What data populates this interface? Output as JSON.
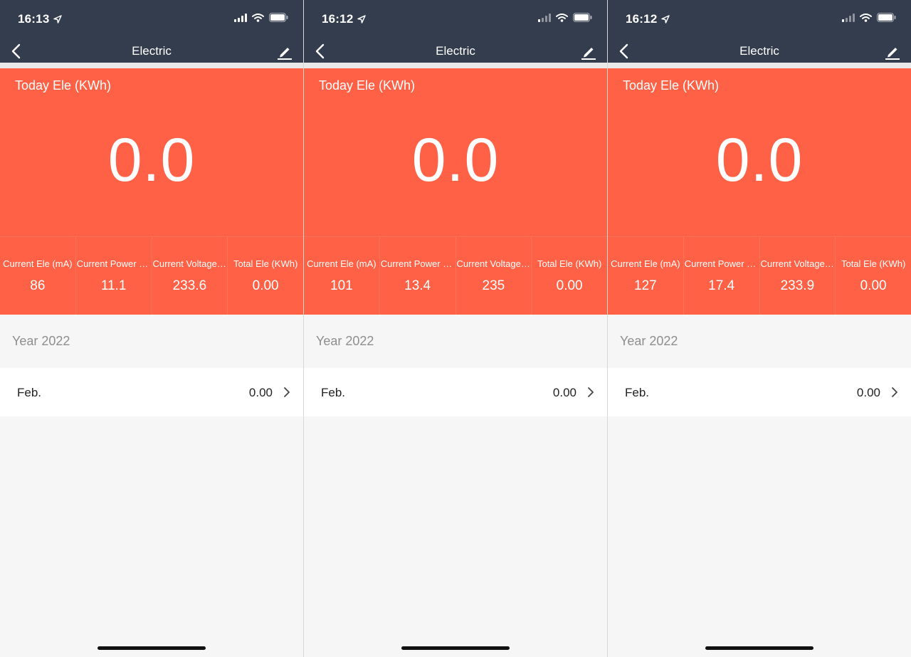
{
  "colors": {
    "header": "#343d4e",
    "card": "#fe6145",
    "background": "#f6f6f6"
  },
  "icons": [
    "location-arrow-icon",
    "signal-icon",
    "wifi-icon",
    "battery-icon",
    "back-chevron-icon",
    "edit-pencil-icon",
    "chevron-right-icon"
  ],
  "screens": [
    {
      "time": "16:13",
      "title": "Electric",
      "today_label": "Today Ele (KWh)",
      "today_value": "0.0",
      "stats": [
        {
          "label": "Current Ele (mA)",
          "value": "86"
        },
        {
          "label": "Current Power (W)",
          "value": "11.1"
        },
        {
          "label": "Current Voltage (V)",
          "value": "233.6"
        },
        {
          "label": "Total Ele (KWh)",
          "value": "0.00"
        }
      ],
      "year": "Year 2022",
      "month": {
        "label": "Feb.",
        "value": "0.00"
      }
    },
    {
      "time": "16:12",
      "title": "Electric",
      "today_label": "Today Ele (KWh)",
      "today_value": "0.0",
      "stats": [
        {
          "label": "Current Ele (mA)",
          "value": "101"
        },
        {
          "label": "Current Power (W)",
          "value": "13.4"
        },
        {
          "label": "Current Voltage (V)",
          "value": "235"
        },
        {
          "label": "Total Ele (KWh)",
          "value": "0.00"
        }
      ],
      "year": "Year 2022",
      "month": {
        "label": "Feb.",
        "value": "0.00"
      }
    },
    {
      "time": "16:12",
      "title": "Electric",
      "today_label": "Today Ele (KWh)",
      "today_value": "0.0",
      "stats": [
        {
          "label": "Current Ele (mA)",
          "value": "127"
        },
        {
          "label": "Current Power (W)",
          "value": "17.4"
        },
        {
          "label": "Current Voltage (V)",
          "value": "233.9"
        },
        {
          "label": "Total Ele (KWh)",
          "value": "0.00"
        }
      ],
      "year": "Year 2022",
      "month": {
        "label": "Feb.",
        "value": "0.00"
      }
    }
  ]
}
